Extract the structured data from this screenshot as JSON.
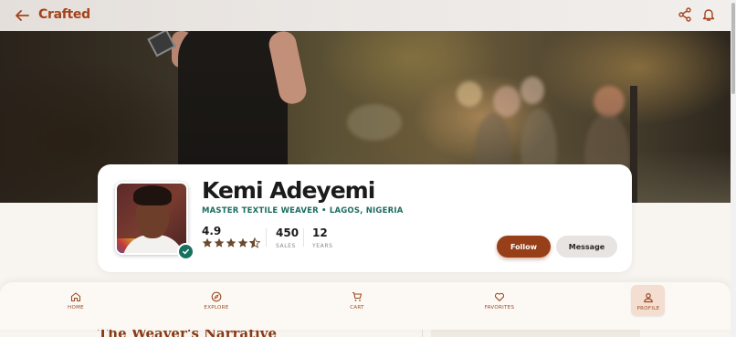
{
  "app": {
    "brand": "Crafted"
  },
  "header": {
    "back_icon": "arrow-left-icon",
    "share_icon": "share-icon",
    "notifications_icon": "bell-icon"
  },
  "profile": {
    "name": "Kemi Adeyemi",
    "subtitle": "MASTER TEXTILE WEAVER • LAGOS, NIGERIA",
    "rating": "4.9",
    "stars": 4.5,
    "stats": [
      {
        "value": "450",
        "label": "SALES"
      },
      {
        "value": "12",
        "label": "YEARS"
      }
    ],
    "follow_label": "Follow",
    "message_label": "Message",
    "verified_icon": "verified-check-icon"
  },
  "section": {
    "title": "The Weaver's Narrative"
  },
  "nav": {
    "items": [
      {
        "label": "HOME",
        "icon": "home-icon"
      },
      {
        "label": "EXPLORE",
        "icon": "compass-icon"
      },
      {
        "label": "CART",
        "icon": "cart-icon"
      },
      {
        "label": "FAVORITES",
        "icon": "heart-icon"
      },
      {
        "label": "PROFILE",
        "icon": "person-icon",
        "active": true
      }
    ]
  },
  "colors": {
    "brand": "#a4431a",
    "accent_teal": "#1c6c5f",
    "follow_button": "#963f18",
    "message_button": "#e7e4e1"
  }
}
